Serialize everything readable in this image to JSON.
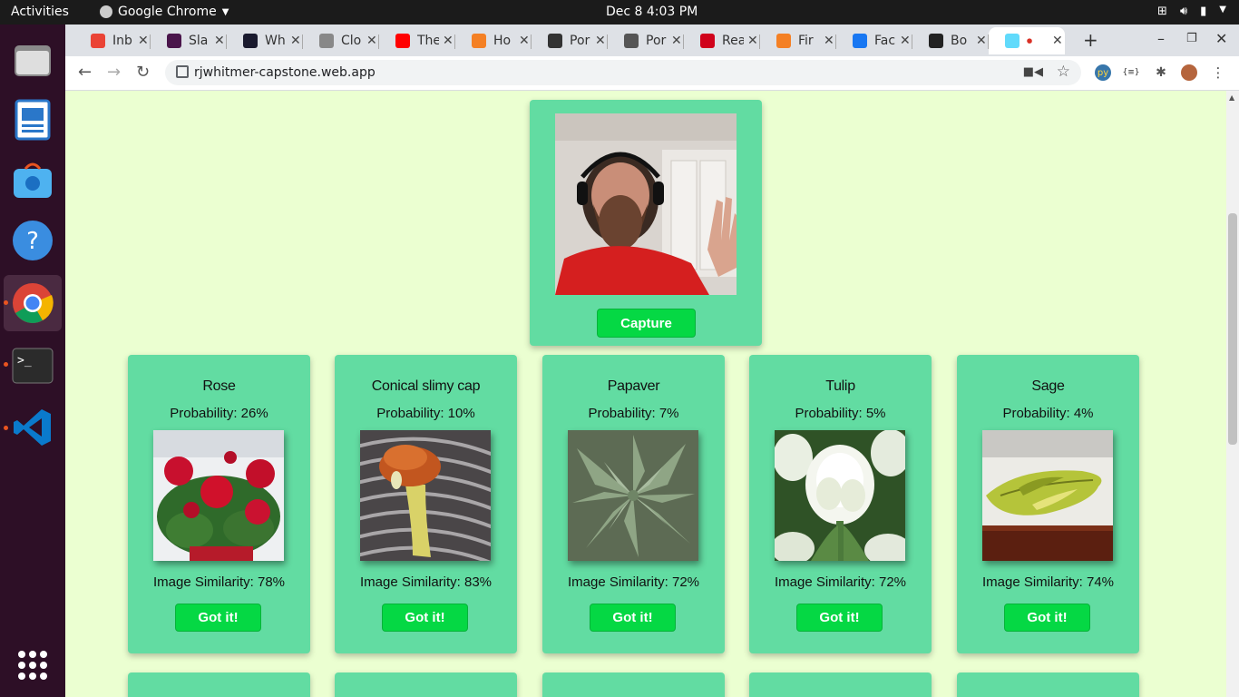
{
  "topbar": {
    "activities": "Activities",
    "app_name": "Google Chrome",
    "clock": "Dec 8   4:03 PM"
  },
  "browser": {
    "tabs": [
      {
        "label": "Inb",
        "icon": "gmail-icon",
        "color": "#ea4335"
      },
      {
        "label": "Sla",
        "icon": "slack-icon",
        "color": "#4a154b"
      },
      {
        "label": "Wh",
        "icon": "code-icon",
        "color": "#1a1a2e"
      },
      {
        "label": "Clo",
        "icon": "loading-icon",
        "color": "#888888"
      },
      {
        "label": "The",
        "icon": "youtube-icon",
        "color": "#ff0000"
      },
      {
        "label": "Ho",
        "icon": "stackoverflow-icon",
        "color": "#f48024"
      },
      {
        "label": "Por",
        "icon": "trello-icon",
        "color": "#333333"
      },
      {
        "label": "Por",
        "icon": "globe-icon",
        "color": "#555555"
      },
      {
        "label": "Rea",
        "icon": "graph-icon",
        "color": "#d0021b"
      },
      {
        "label": "Fir",
        "icon": "stackoverflow-icon",
        "color": "#f48024"
      },
      {
        "label": "Fac",
        "icon": "facebook-icon",
        "color": "#1877f2"
      },
      {
        "label": "Bo",
        "icon": "react-icon",
        "color": "#222222"
      },
      {
        "label": "",
        "icon": "react-icon",
        "color": "#61dafb",
        "active": true
      }
    ],
    "url": "rjwhitmer-capstone.web.app"
  },
  "camera": {
    "capture_label": "Capture"
  },
  "predictions": [
    {
      "name": "Rose",
      "probability": "Probability: 26%",
      "similarity": "Image Similarity: 78%",
      "button": "Got it!"
    },
    {
      "name": "Conical slimy cap",
      "probability": "Probability: 10%",
      "similarity": "Image Similarity: 83%",
      "button": "Got it!"
    },
    {
      "name": "Papaver",
      "probability": "Probability: 7%",
      "similarity": "Image Similarity: 72%",
      "button": "Got it!"
    },
    {
      "name": "Tulip",
      "probability": "Probability: 5%",
      "similarity": "Image Similarity: 72%",
      "button": "Got it!"
    },
    {
      "name": "Sage",
      "probability": "Probability: 4%",
      "similarity": "Image Similarity: 74%",
      "button": "Got it!"
    }
  ],
  "colors": {
    "page_background": "#ebffd1",
    "card": "#62dca2",
    "button": "#05d844"
  }
}
